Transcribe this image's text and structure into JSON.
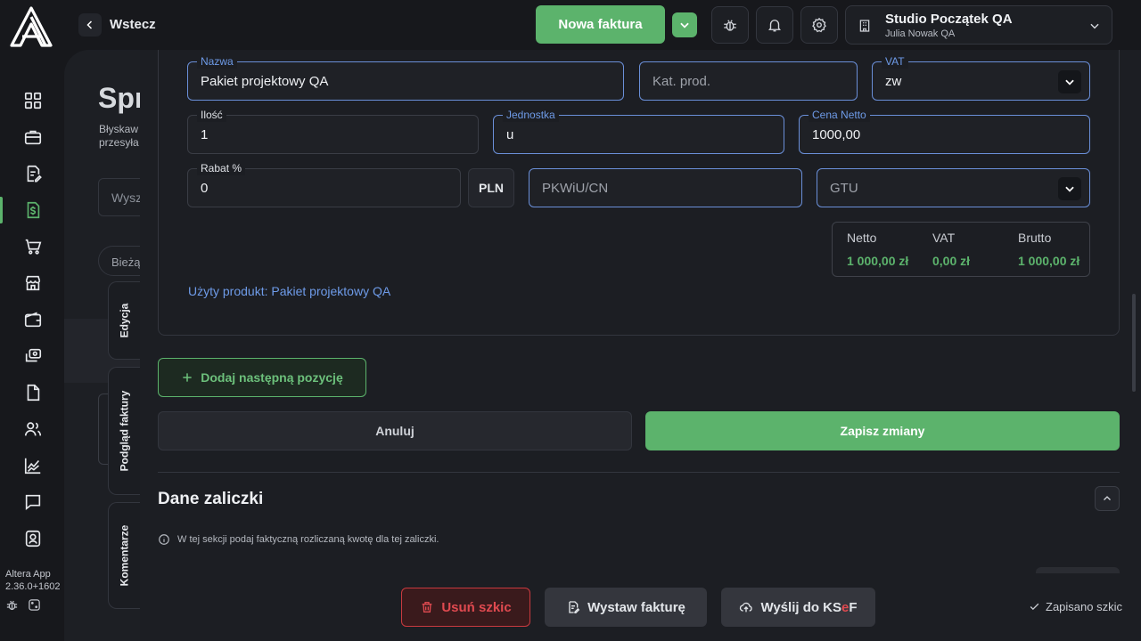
{
  "app": {
    "version_name": "Altera App",
    "version_number": "2.36.0+1602"
  },
  "nav": {
    "items": [
      {
        "icon": "dashboard-icon"
      },
      {
        "icon": "briefcase-icon"
      },
      {
        "icon": "document-edit-icon"
      },
      {
        "icon": "invoice-dollar-icon",
        "active": true
      },
      {
        "icon": "cart-icon"
      },
      {
        "icon": "store-icon"
      },
      {
        "icon": "wallet-icon"
      },
      {
        "icon": "money-transfer-icon"
      },
      {
        "icon": "file-icon"
      },
      {
        "icon": "users-icon"
      },
      {
        "icon": "chart-line-icon"
      },
      {
        "icon": "chat-icon"
      },
      {
        "icon": "contact-card-icon"
      }
    ]
  },
  "topbar": {
    "back_label": "Wstecz",
    "new_invoice_label": "Nowa faktura",
    "org_name": "Studio Początek QA",
    "org_user": "Julia Nowak QA"
  },
  "background_page": {
    "title": "Spr",
    "desc_line1": "Błyskaw",
    "desc_line2": "przesyła",
    "search_placeholder": "Wysz",
    "chip_label": "Bieżą"
  },
  "side_tabs": {
    "edit": "Edycja",
    "preview": "Podgląd faktury",
    "comments": "Komentarze"
  },
  "item_form": {
    "name": {
      "label": "Nazwa",
      "value": "Pakiet projektowy QA"
    },
    "category": {
      "placeholder": "Kat. prod."
    },
    "vat": {
      "label": "VAT",
      "value": "zw"
    },
    "quantity": {
      "label": "Ilość",
      "value": "1"
    },
    "unit": {
      "label": "Jednostka",
      "value": "u"
    },
    "net_price": {
      "label": "Cena Netto",
      "value": "1000,00"
    },
    "discount": {
      "label": "Rabat %",
      "value": "0"
    },
    "currency": "PLN",
    "pkwiu": {
      "placeholder": "PKWiU/CN"
    },
    "gtu": {
      "placeholder": "GTU"
    },
    "totals": {
      "net_label": "Netto",
      "net_value": "1 000,00 zł",
      "vat_label": "VAT",
      "vat_value": "0,00 zł",
      "gross_label": "Brutto",
      "gross_value": "1 000,00 zł"
    },
    "used_product": "Użyty produkt: Pakiet projektowy QA"
  },
  "actions": {
    "add_item": "Dodaj następną pozycję",
    "cancel": "Anuluj",
    "save": "Zapisz zmiany"
  },
  "advance_section": {
    "title": "Dane zaliczki",
    "info": "W tej sekcji podaj faktyczną rozliczaną kwotę dla tej zaliczki."
  },
  "bottom_bar": {
    "delete_draft": "Usuń szkic",
    "issue_invoice": "Wystaw fakturę",
    "send_ksef_prefix": "Wyślij do KS",
    "send_ksef_e": "e",
    "send_ksef_suffix": "F",
    "saved_note": "Zapisano szkic"
  },
  "colors": {
    "accent_green": "#5cb36c",
    "focus_blue": "#6a8fd8",
    "danger_red": "#e04a50",
    "background": "#17181c"
  }
}
